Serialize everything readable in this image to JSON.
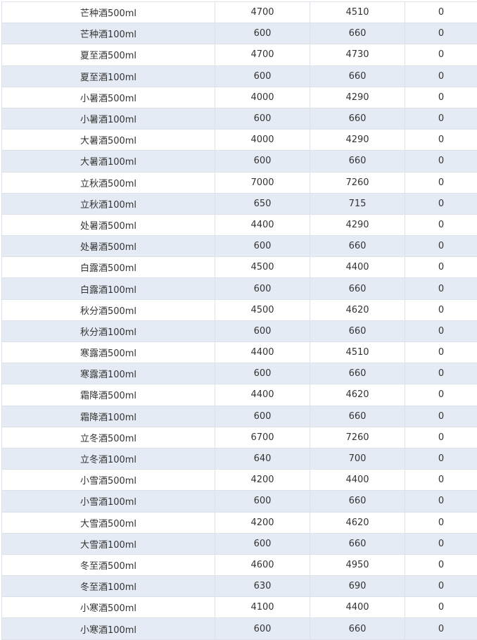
{
  "table": {
    "rows": [
      {
        "name": "芒种酒500ml",
        "a": "4700",
        "b": "4510",
        "c": "0"
      },
      {
        "name": "芒种酒100ml",
        "a": "600",
        "b": "660",
        "c": "0"
      },
      {
        "name": "夏至酒500ml",
        "a": "4700",
        "b": "4730",
        "c": "0"
      },
      {
        "name": "夏至酒100ml",
        "a": "600",
        "b": "660",
        "c": "0"
      },
      {
        "name": "小暑酒500ml",
        "a": "4000",
        "b": "4290",
        "c": "0"
      },
      {
        "name": "小暑酒100ml",
        "a": "600",
        "b": "660",
        "c": "0"
      },
      {
        "name": "大暑酒500ml",
        "a": "4000",
        "b": "4290",
        "c": "0"
      },
      {
        "name": "大暑酒100ml",
        "a": "600",
        "b": "660",
        "c": "0"
      },
      {
        "name": "立秋酒500ml",
        "a": "7000",
        "b": "7260",
        "c": "0"
      },
      {
        "name": "立秋酒100ml",
        "a": "650",
        "b": "715",
        "c": "0"
      },
      {
        "name": "处暑酒500ml",
        "a": "4400",
        "b": "4290",
        "c": "0"
      },
      {
        "name": "处暑酒500ml",
        "a": "600",
        "b": "660",
        "c": "0"
      },
      {
        "name": "白露酒500ml",
        "a": "4500",
        "b": "4400",
        "c": "0"
      },
      {
        "name": "白露酒100ml",
        "a": "600",
        "b": "660",
        "c": "0"
      },
      {
        "name": "秋分酒500ml",
        "a": "4500",
        "b": "4620",
        "c": "0"
      },
      {
        "name": "秋分酒100ml",
        "a": "600",
        "b": "660",
        "c": "0"
      },
      {
        "name": "寒露酒500ml",
        "a": "4400",
        "b": "4510",
        "c": "0"
      },
      {
        "name": "寒露酒100ml",
        "a": "600",
        "b": "660",
        "c": "0"
      },
      {
        "name": "霜降酒500ml",
        "a": "4400",
        "b": "4620",
        "c": "0"
      },
      {
        "name": "霜降酒100ml",
        "a": "600",
        "b": "660",
        "c": "0"
      },
      {
        "name": "立冬酒500ml",
        "a": "6700",
        "b": "7260",
        "c": "0"
      },
      {
        "name": "立冬酒100ml",
        "a": "640",
        "b": "700",
        "c": "0"
      },
      {
        "name": "小雪酒500ml",
        "a": "4200",
        "b": "4400",
        "c": "0"
      },
      {
        "name": "小雪酒100ml",
        "a": "600",
        "b": "660",
        "c": "0"
      },
      {
        "name": "大雪酒500ml",
        "a": "4200",
        "b": "4620",
        "c": "0"
      },
      {
        "name": "大雪酒100ml",
        "a": "600",
        "b": "660",
        "c": "0"
      },
      {
        "name": "冬至酒500ml",
        "a": "4600",
        "b": "4950",
        "c": "0"
      },
      {
        "name": "冬至酒100ml",
        "a": "630",
        "b": "690",
        "c": "0"
      },
      {
        "name": "小寒酒500ml",
        "a": "4100",
        "b": "4400",
        "c": "0"
      },
      {
        "name": "小寒酒100ml",
        "a": "600",
        "b": "660",
        "c": "0"
      }
    ]
  },
  "colors": {
    "row_alt_bg": "#e5ebf4",
    "row_bg": "#ffffff",
    "grid_line": "#dde2ea",
    "text": "#333333"
  }
}
